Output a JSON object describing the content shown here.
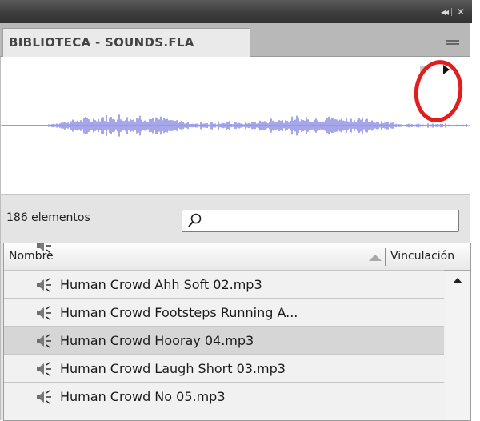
{
  "window": {
    "collapse_glyph": "◂◂",
    "close_glyph": "✕"
  },
  "panel": {
    "tab_title": "BIBLIOTECA - SOUNDS.FLA",
    "menu_icon": "panel-menu-icon"
  },
  "preview": {
    "waveform_color": "#8f8fe6",
    "highlight_color": "#e11d1d",
    "controls": [
      "stop-icon",
      "play-icon"
    ]
  },
  "library": {
    "item_count": "186 elementos",
    "search": {
      "value": "",
      "placeholder": ""
    },
    "columns": {
      "name": "Nombre",
      "linkage": "Vinculación"
    },
    "items": [
      {
        "label": "Human Crowd Ahh Soft 02.mp3",
        "icon": "sound-icon",
        "selected": false
      },
      {
        "label": "Human Crowd Footsteps Running A...",
        "icon": "sound-icon",
        "selected": false
      },
      {
        "label": "Human Crowd Hooray 04.mp3",
        "icon": "sound-icon",
        "selected": true
      },
      {
        "label": "Human Crowd Laugh Short 03.mp3",
        "icon": "sound-icon",
        "selected": false
      },
      {
        "label": "Human Crowd No 05.mp3",
        "icon": "sound-icon",
        "selected": false
      }
    ]
  }
}
